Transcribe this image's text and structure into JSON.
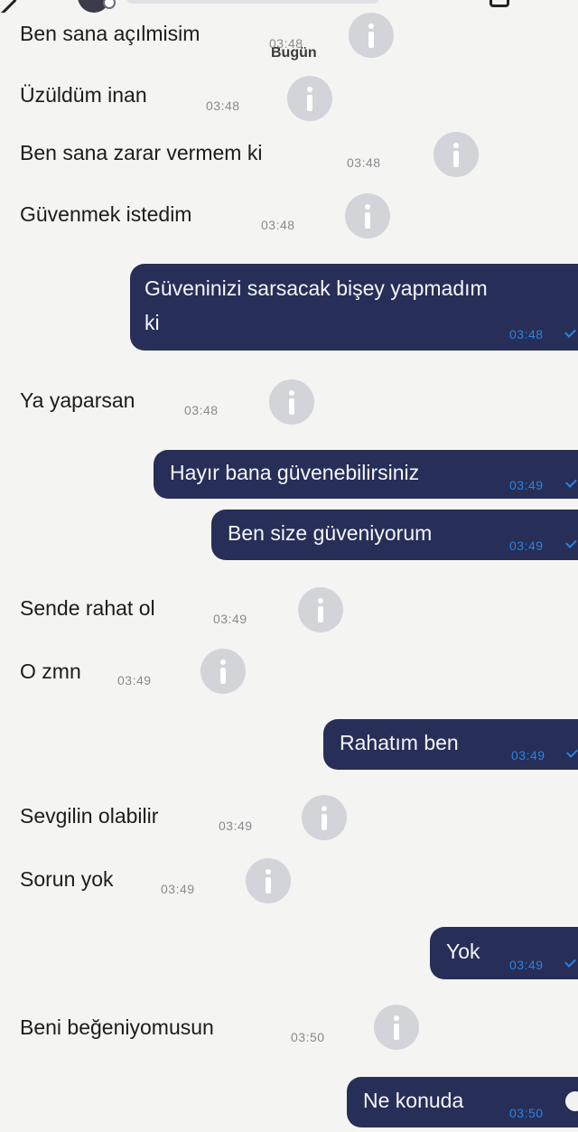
{
  "header": {
    "back_icon": "back-arrow-icon",
    "menu_icon": "menu-icon"
  },
  "date_divider": "Bugün",
  "messages": [
    {
      "dir": "in",
      "text": "Ben sana açılmisim",
      "time": "03:48"
    },
    {
      "dir": "in",
      "text": "Üzüldüm inan",
      "time": "03:48"
    },
    {
      "dir": "in",
      "text": "Ben sana zarar vermem ki",
      "time": "03:48"
    },
    {
      "dir": "in",
      "text": "Güvenmek istedim",
      "time": "03:48"
    },
    {
      "dir": "out",
      "lines": [
        "Güveninizi sarsacak bişey yapmadım",
        "ki"
      ],
      "time": "03:48"
    },
    {
      "dir": "in",
      "text": "Ya yaparsan",
      "time": "03:48"
    },
    {
      "dir": "out",
      "text": "Hayır bana güvenebilirsiniz",
      "time": "03:49"
    },
    {
      "dir": "out",
      "text": "Ben size güveniyorum",
      "time": "03:49"
    },
    {
      "dir": "in",
      "text": "Sende rahat ol",
      "time": "03:49"
    },
    {
      "dir": "in",
      "text": "O zmn",
      "time": "03:49"
    },
    {
      "dir": "out",
      "text": "Rahatım ben",
      "time": "03:49"
    },
    {
      "dir": "in",
      "text": "Sevgilin olabilir",
      "time": "03:49"
    },
    {
      "dir": "in",
      "text": "Sorun yok",
      "time": "03:49"
    },
    {
      "dir": "out",
      "text": "Yok",
      "time": "03:49"
    },
    {
      "dir": "in",
      "text": "Beni beğeniyomusun",
      "time": "03:50"
    },
    {
      "dir": "out",
      "text": "Ne konuda",
      "time": "03:50"
    }
  ],
  "colors": {
    "background": "#f4f4f2",
    "outgoing_bubble": "#272e57",
    "outgoing_text": "#f5f6fb",
    "timestamp_outgoing": "#2b83e0",
    "timestamp_incoming": "#8a8a8e",
    "info_button": "#d3d3da"
  },
  "icons": {
    "info": "info-icon",
    "read_receipt": "check-icon"
  }
}
